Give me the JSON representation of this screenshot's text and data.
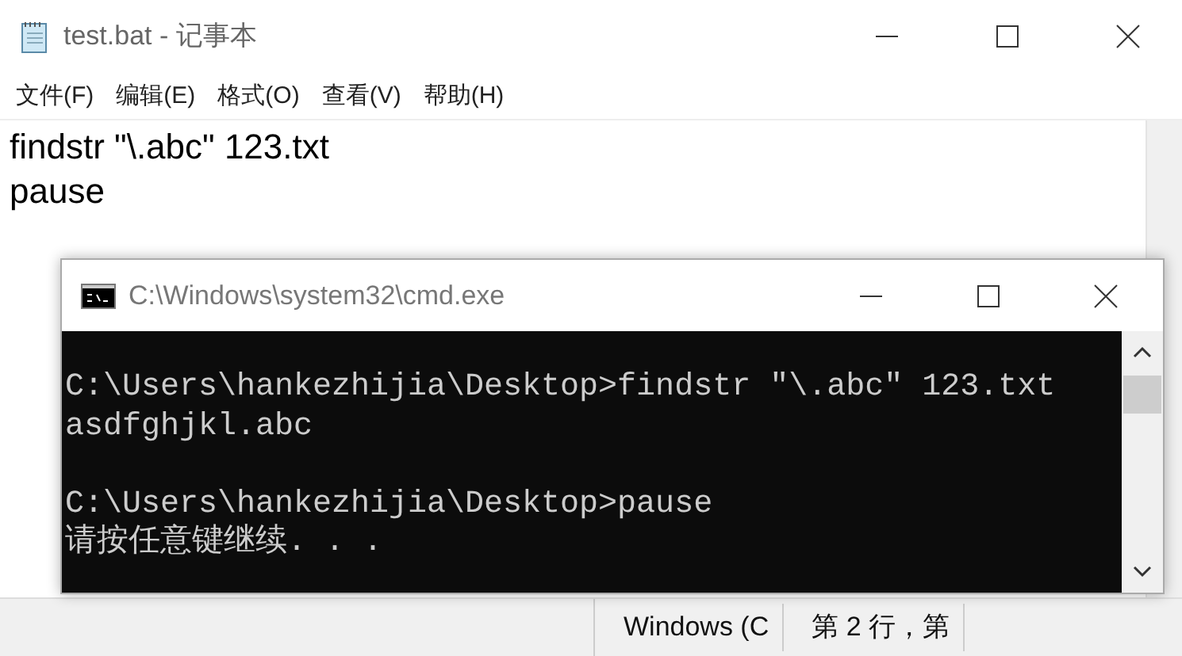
{
  "window": {
    "title": "test.bat - 记事本"
  },
  "menu": [
    "文件(F)",
    "编辑(E)",
    "格式(O)",
    "查看(V)",
    "帮助(H)"
  ],
  "editor": {
    "lines": [
      "findstr \"\\.abc\" 123.txt",
      "pause"
    ]
  },
  "console_window": {
    "title": "C:\\Windows\\system32\\cmd.exe",
    "blocks": [
      [
        "C:\\Users\\hankezhijia\\Desktop>findstr \"\\.abc\" 123.txt",
        "asdfghjkl.abc"
      ],
      [
        "C:\\Users\\hankezhijia\\Desktop>pause",
        "请按任意键继续. . ."
      ]
    ]
  },
  "status_bar": [
    "Windows (C",
    "第 2 行，第"
  ]
}
